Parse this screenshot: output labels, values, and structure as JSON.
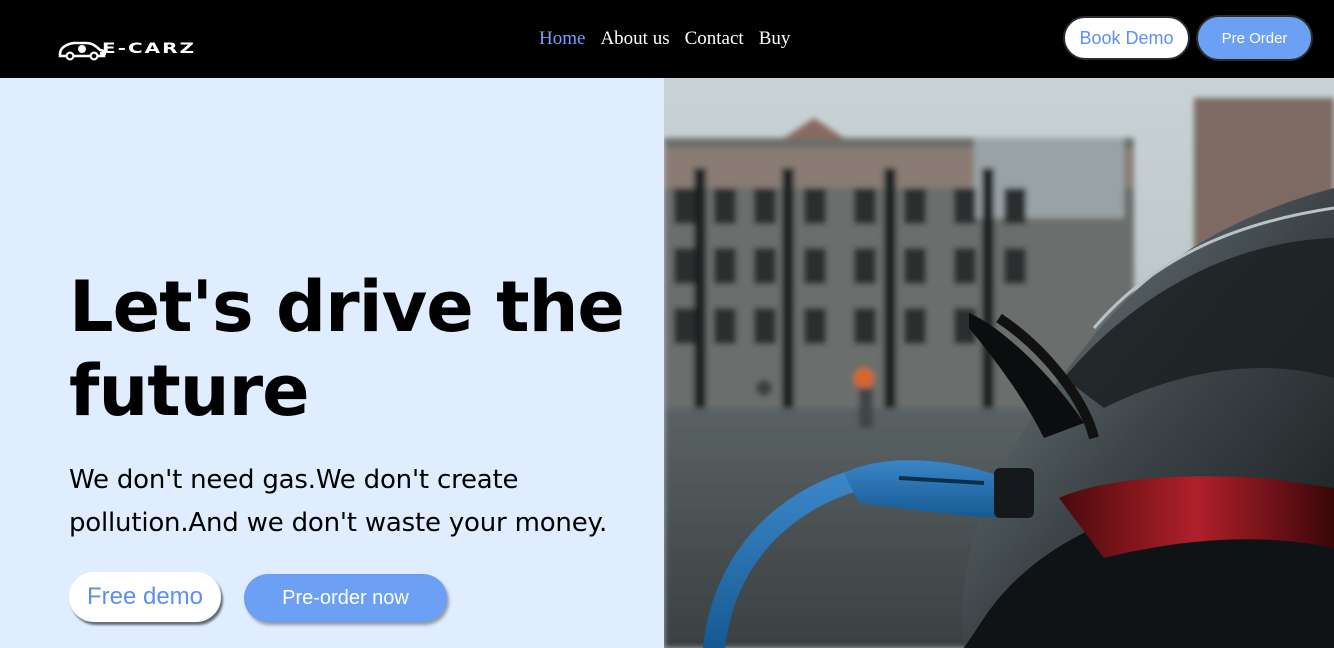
{
  "brand": {
    "logo_text": "E-CARZ",
    "logo_icon": "car-plug-icon"
  },
  "nav": {
    "links": [
      {
        "label": "Home",
        "active": true
      },
      {
        "label": "About us",
        "active": false
      },
      {
        "label": "Contact",
        "active": false
      },
      {
        "label": "Buy",
        "active": false
      }
    ],
    "book_demo_label": "Book Demo",
    "pre_order_label": "Pre Order"
  },
  "hero": {
    "title": "Let's drive the future",
    "subtitle": "We don't need gas.We don't create pollution.And we don't waste your money.",
    "free_demo_label": "Free demo",
    "pre_order_now_label": "Pre-order now",
    "image": "electric-car-charging-photo"
  },
  "colors": {
    "accent": "#6ca0f5",
    "nav_active": "#6fa0ff",
    "hero_bg": "#e0edff",
    "navbar_bg": "#000000"
  }
}
